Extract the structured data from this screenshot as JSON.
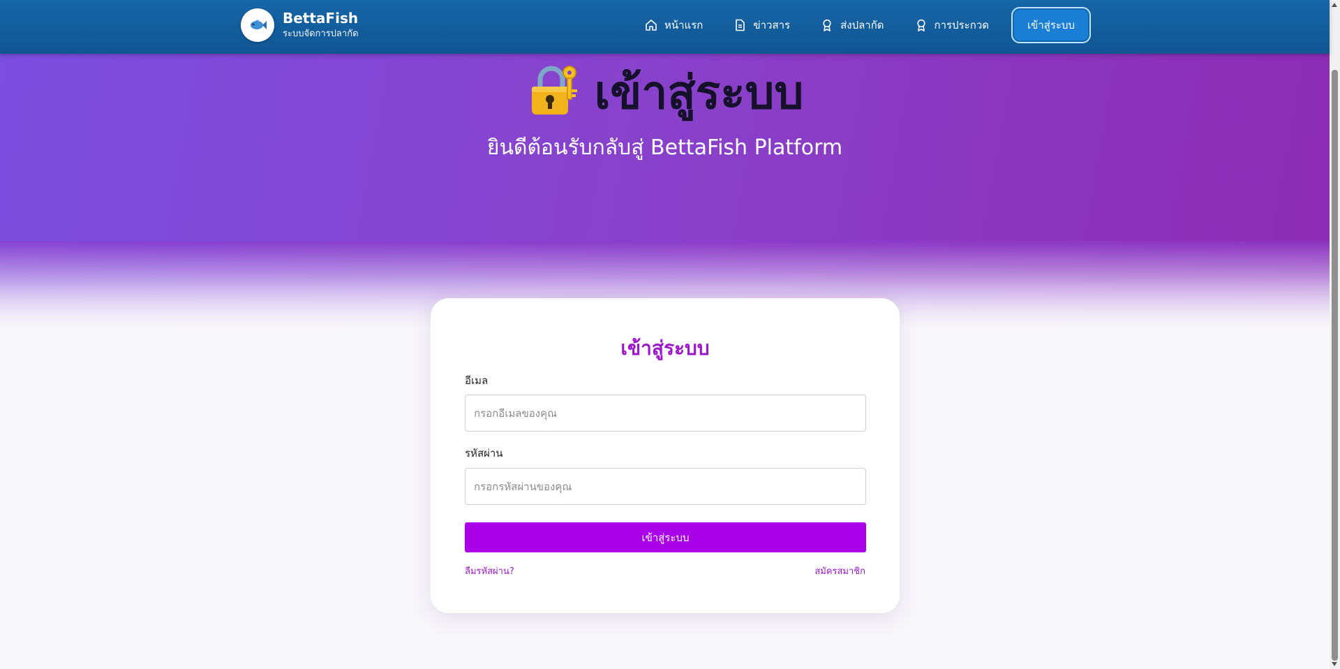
{
  "header": {
    "brand_title": "BettaFish",
    "brand_subtitle": "ระบบจัดการปลากัด",
    "logo_icon": "fish-icon",
    "nav": [
      {
        "label": "หน้าแรก",
        "icon": "home-icon"
      },
      {
        "label": "ข่าวสาร",
        "icon": "document-icon"
      },
      {
        "label": "ส่งปลากัด",
        "icon": "award-icon"
      },
      {
        "label": "การประกวด",
        "icon": "award-icon"
      }
    ],
    "login_label": "เข้าสู่ระบบ"
  },
  "hero": {
    "icon": "lock-key-icon",
    "title": "เข้าสู่ระบบ",
    "subtitle": "ยินดีต้อนรับกลับสู่ BettaFish Platform"
  },
  "form": {
    "title": "เข้าสู่ระบบ",
    "email_label": "อีเมล",
    "email_placeholder": "กรอกอีเมลของคุณ",
    "email_value": "",
    "password_label": "รหัสผ่าน",
    "password_placeholder": "กรอกรหัสผ่านของคุณ",
    "password_value": "",
    "submit_label": "เข้าสู่ระบบ",
    "forgot_label": "ลืมรหัสผ่าน?",
    "register_label": "สมัครสมาชิก"
  },
  "colors": {
    "header_bg": "#1766a8",
    "hero_bg": "#8a3fc8",
    "accent": "#aa00e8",
    "login_button": "#1a7fd4"
  }
}
